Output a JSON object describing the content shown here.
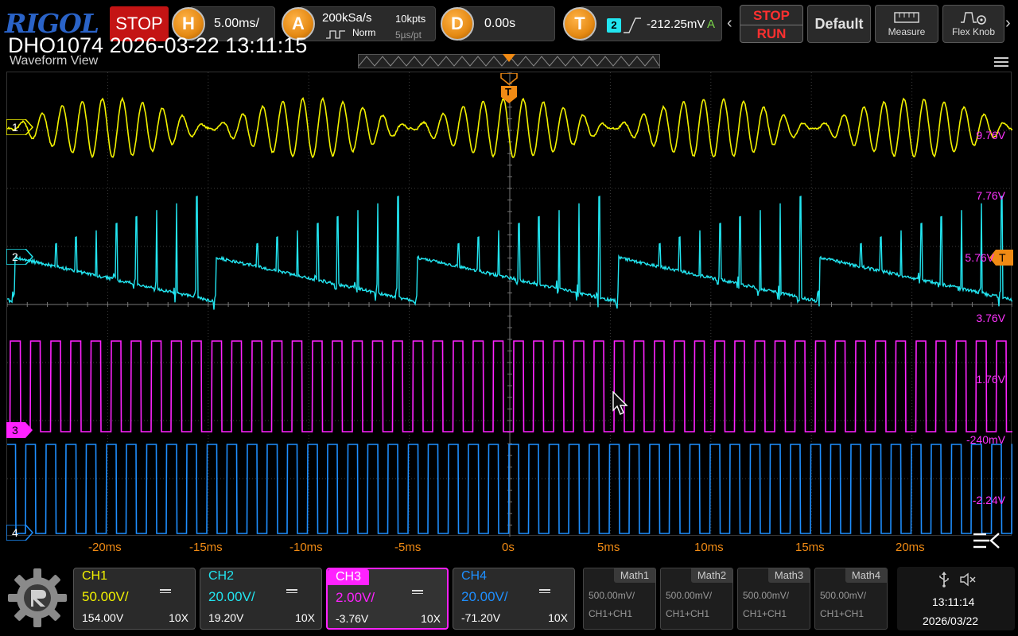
{
  "brand": "RIGOL",
  "header_line": "DHO1074 2026-03-22 13:11:15",
  "run_state": "STOP",
  "horizontal": {
    "letter": "H",
    "scale": "5.00ms/"
  },
  "acquire": {
    "letter": "A",
    "sample_rate": "200kSa/s",
    "points": "10kpts",
    "mode": "Norm",
    "resolution": "5µs/pt"
  },
  "delay": {
    "letter": "D",
    "value": "0.00s"
  },
  "trigger": {
    "letter": "T",
    "source": "2",
    "level": "-212.25mV",
    "status": "A"
  },
  "buttons": {
    "stop_label": "STOP",
    "run_label": "RUN",
    "default_label": "Default",
    "measure_label": "Measure",
    "flexknob_label": "Flex Knob"
  },
  "waveform_view": {
    "title": "Waveform View",
    "trigger_marker": "T",
    "right_labels": [
      "9.76V",
      "7.76V",
      "5.76V",
      "3.76V",
      "1.76V",
      "-240mV",
      "-2.24V"
    ],
    "channel_markers": [
      "1",
      "2",
      "3",
      "4"
    ],
    "time_labels": [
      "-20ms",
      "-15ms",
      "-10ms",
      "-5ms",
      "0s",
      "5ms",
      "10ms",
      "15ms",
      "20ms"
    ]
  },
  "channels": [
    {
      "tab": "CH1",
      "scale": "50.00V/",
      "offset": "154.00V",
      "probe": "10X",
      "color": "#f2f200",
      "active": false
    },
    {
      "tab": "CH2",
      "scale": "20.00V/",
      "offset": "19.20V",
      "probe": "10X",
      "color": "#22e5f0",
      "active": false
    },
    {
      "tab": "CH3",
      "scale": "2.00V/",
      "offset": "-3.76V",
      "probe": "10X",
      "color": "#ff22ff",
      "active": true
    },
    {
      "tab": "CH4",
      "scale": "20.00V/",
      "offset": "-71.20V",
      "probe": "10X",
      "color": "#1e8fff",
      "active": false
    }
  ],
  "math": [
    {
      "tab": "Math1",
      "scale": "500.00mV/",
      "source": "CH1+CH1"
    },
    {
      "tab": "Math2",
      "scale": "500.00mV/",
      "source": "CH1+CH1"
    },
    {
      "tab": "Math3",
      "scale": "500.00mV/",
      "source": "CH1+CH1"
    },
    {
      "tab": "Math4",
      "scale": "500.00mV/",
      "source": "CH1+CH1"
    }
  ],
  "clock": {
    "time": "13:11:14",
    "date": "2026/03/22"
  },
  "colors": {
    "accent_orange": "#f08a14",
    "stop_red": "#c41414",
    "ch1": "#f2f200",
    "ch2": "#22e5f0",
    "ch3": "#ff22ff",
    "ch4": "#1e8fff"
  }
}
